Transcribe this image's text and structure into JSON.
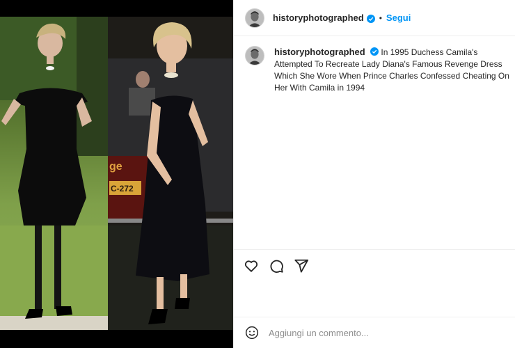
{
  "post": {
    "username": "historyphotographed",
    "follow_label": "Segui",
    "separator": "•",
    "caption": "In 1995 Duchess Camila's Attempted To Recreate Lady Diana's Famous Revenge Dress Which She Wore When Prince Charles Confessed Cheating On Her With Camila in 1994",
    "verified_color": "#0095f6",
    "follow_color": "#0095f6"
  },
  "media": {
    "left_photo_icon": "woman-in-black-dress-photo",
    "right_photo_icon": "woman-in-velvet-dress-photo"
  },
  "actions": {
    "like_icon": "heart-icon",
    "comment_icon": "comment-bubble-icon",
    "share_icon": "paper-plane-icon"
  },
  "comment": {
    "placeholder": "Aggiungi un commento...",
    "emoji_icon": "emoji-smiley-icon"
  }
}
